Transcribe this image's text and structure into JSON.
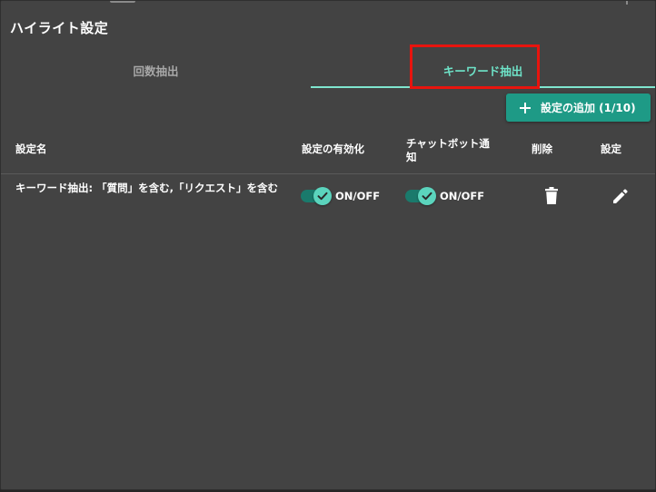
{
  "dialog": {
    "title": "ハイライト設定"
  },
  "tabs": [
    {
      "label": "回数抽出",
      "active": false
    },
    {
      "label": "キーワード抽出",
      "active": true
    }
  ],
  "add_button": {
    "label": "設定の追加 (1/10)",
    "icon": "plus-icon"
  },
  "table": {
    "headers": {
      "name": "設定名",
      "enabled": "設定の有効化",
      "chatbot": "チャットボット通知",
      "delete": "削除",
      "edit": "設定"
    },
    "rows": [
      {
        "name": "キーワード抽出: 「質問」を含む,「リクエスト」を含む",
        "enabled": true,
        "enabled_label": "ON/OFF",
        "chatbot": true,
        "chatbot_label": "ON/OFF",
        "delete_icon": "trash-icon",
        "edit_icon": "pencil-icon"
      }
    ]
  },
  "colors": {
    "background": "#434343",
    "accent": "#6ee3c8",
    "button": "#1e9a86",
    "highlight_box": "#e8140e"
  }
}
